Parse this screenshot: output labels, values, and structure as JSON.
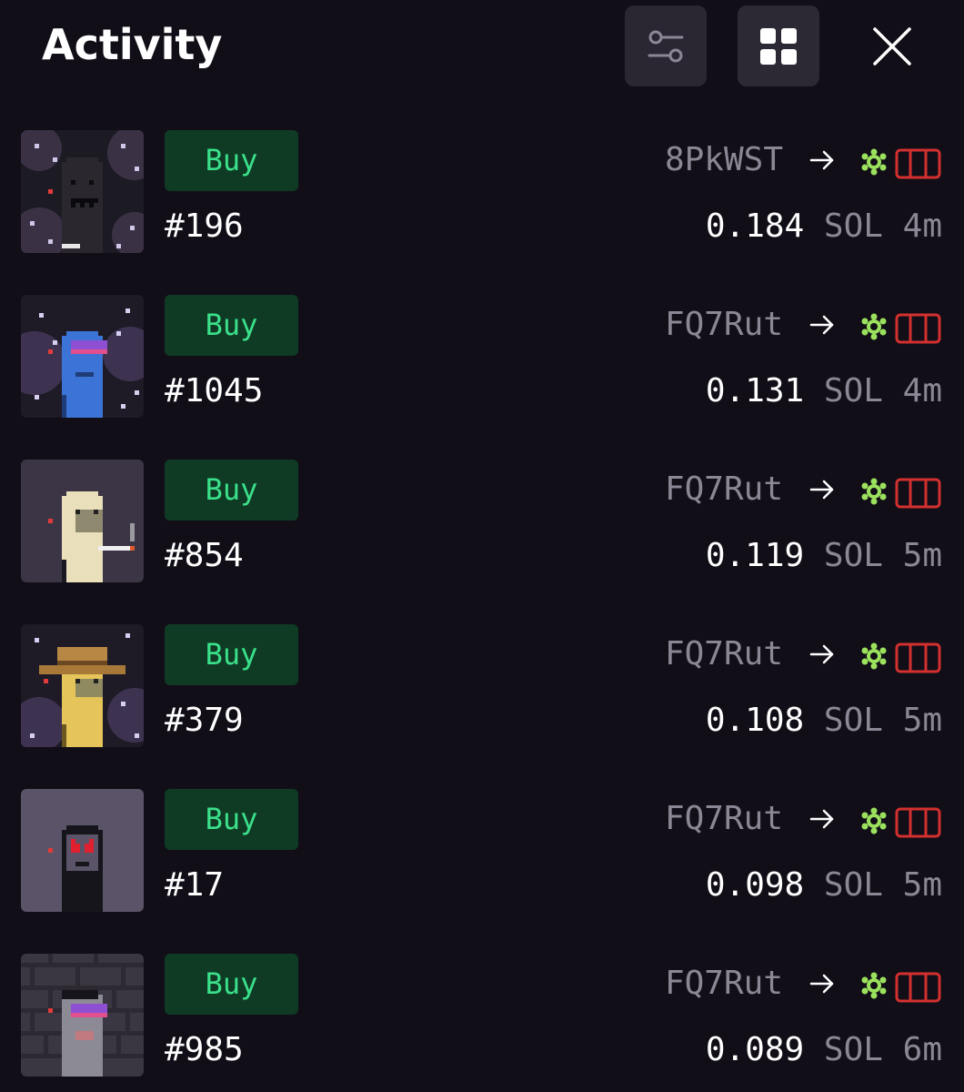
{
  "header": {
    "title": "Activity"
  },
  "colors": {
    "background": "#110e17",
    "buy_bg": "#0f3b25",
    "buy_text": "#3be08a",
    "muted": "#8b8794",
    "market_icon": "#9be15d",
    "wallet_icon": "#d3302f"
  },
  "activity": [
    {
      "action": "Buy",
      "token": "#196",
      "from": "8PkWST",
      "price": "0.184",
      "unit": "SOL",
      "time": "4m",
      "avatar": "robot-dark"
    },
    {
      "action": "Buy",
      "token": "#1045",
      "from": "FQ7Rut",
      "price": "0.131",
      "unit": "SOL",
      "time": "4m",
      "avatar": "blue-shades"
    },
    {
      "action": "Buy",
      "token": "#854",
      "from": "FQ7Rut",
      "price": "0.119",
      "unit": "SOL",
      "time": "5m",
      "avatar": "cream-cigarette"
    },
    {
      "action": "Buy",
      "token": "#379",
      "from": "FQ7Rut",
      "price": "0.108",
      "unit": "SOL",
      "time": "5m",
      "avatar": "yellow-hat"
    },
    {
      "action": "Buy",
      "token": "#17",
      "from": "FQ7Rut",
      "price": "0.098",
      "unit": "SOL",
      "time": "5m",
      "avatar": "dark-heart-eyes"
    },
    {
      "action": "Buy",
      "token": "#985",
      "from": "FQ7Rut",
      "price": "0.089",
      "unit": "SOL",
      "time": "6m",
      "avatar": "gray-brick-shades"
    }
  ]
}
